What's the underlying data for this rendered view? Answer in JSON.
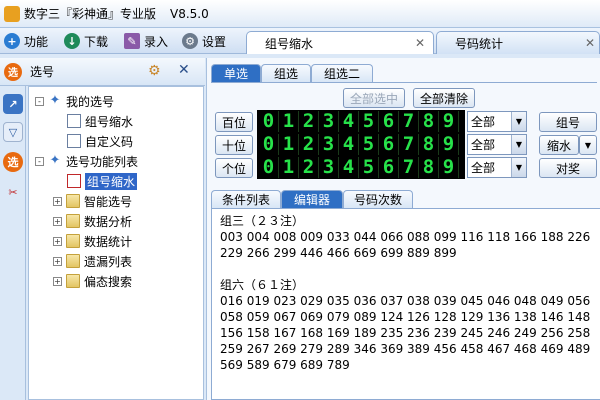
{
  "window": {
    "title": "数字三『彩神通』专业版",
    "version": "V8.5.0"
  },
  "toolbar": [
    {
      "label": "功能",
      "icon": "plus-icon"
    },
    {
      "label": "下载",
      "icon": "download-icon"
    },
    {
      "label": "录入",
      "icon": "import-icon"
    },
    {
      "label": "设置",
      "icon": "settings-icon"
    }
  ],
  "doc_tabs": [
    {
      "label": "组号缩水",
      "active": true
    },
    {
      "label": "号码统计",
      "active": false
    }
  ],
  "side_panel": {
    "title": "选号",
    "icon_label": "选",
    "strip_icons": [
      {
        "name": "chart-icon",
        "label": ""
      },
      {
        "name": "filter-icon",
        "label": ""
      },
      {
        "name": "select-icon",
        "label": "选"
      },
      {
        "name": "tools-icon",
        "label": ""
      }
    ]
  },
  "tree": [
    {
      "label": "我的选号",
      "level": 0,
      "expander": "-",
      "icon": "star"
    },
    {
      "label": "组号缩水",
      "level": 1,
      "expander": "",
      "icon": "doc"
    },
    {
      "label": "自定义码",
      "level": 1,
      "expander": "",
      "icon": "doc"
    },
    {
      "label": "选号功能列表",
      "level": 0,
      "expander": "-",
      "icon": "star"
    },
    {
      "label": "组号缩水",
      "level": 1,
      "expander": "",
      "icon": "doc",
      "selected": true
    },
    {
      "label": "智能选号",
      "level": 1,
      "expander": "+",
      "icon": "folder"
    },
    {
      "label": "数据分析",
      "level": 1,
      "expander": "+",
      "icon": "folder"
    },
    {
      "label": "数据统计",
      "level": 1,
      "expander": "+",
      "icon": "folder"
    },
    {
      "label": "遗漏列表",
      "level": 1,
      "expander": "+",
      "icon": "folder"
    },
    {
      "label": "偏态搜索",
      "level": 1,
      "expander": "+",
      "icon": "folder"
    }
  ],
  "select_tabs": [
    {
      "label": "单选",
      "active": true
    },
    {
      "label": "组选",
      "active": false
    },
    {
      "label": "组选二",
      "active": false
    }
  ],
  "buttons": {
    "select_all": "全部选中",
    "clear_all": "全部清除",
    "group": "组号",
    "shrink": "缩水",
    "shrink_arrow": "▼",
    "check": "对奖"
  },
  "positions": [
    {
      "label": "百位",
      "digits": [
        "0",
        "1",
        "2",
        "3",
        "4",
        "5",
        "6",
        "7",
        "8",
        "9"
      ],
      "select": "全部"
    },
    {
      "label": "十位",
      "digits": [
        "0",
        "1",
        "2",
        "3",
        "4",
        "5",
        "6",
        "7",
        "8",
        "9"
      ],
      "select": "全部"
    },
    {
      "label": "个位",
      "digits": [
        "0",
        "1",
        "2",
        "3",
        "4",
        "5",
        "6",
        "7",
        "8",
        "9"
      ],
      "select": "全部"
    }
  ],
  "result_tabs": [
    {
      "label": "条件列表",
      "active": false
    },
    {
      "label": "编辑器",
      "active": true
    },
    {
      "label": "号码次数",
      "active": false
    }
  ],
  "editor": {
    "text": "组三（２３注）\n003 004 008 009 033 044 066 088 099 116 118 166 188 226\n229 266 299 446 466 669 699 889 899\n\n组六（６１注）\n016 019 023 029 035 036 037 038 039 045 046 048 049 056\n058 059 067 069 079 089 124 126 128 129 136 138 146 148\n156 158 167 168 169 189 235 236 239 245 246 249 256 258\n259 267 269 279 289 346 369 389 456 458 467 468 469 489\n569 589 679 689 789"
  },
  "colors": {
    "accent": "#2f6fc4",
    "led": "#27e24a",
    "selection": "#2f66c8"
  }
}
